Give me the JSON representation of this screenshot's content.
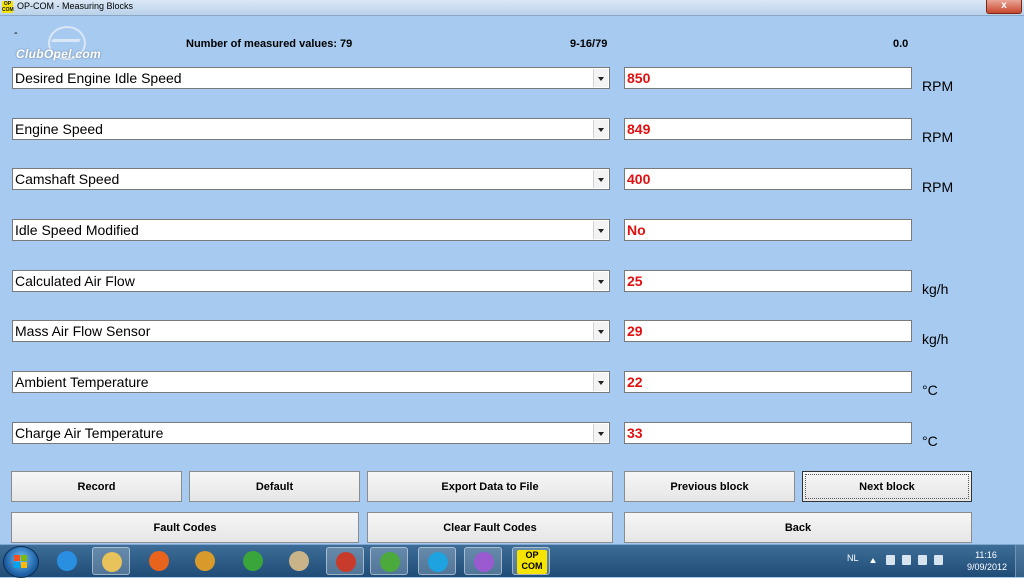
{
  "window": {
    "title": "OP-COM - Measuring Blocks",
    "app_icon_text": "OP COM",
    "close_label": "x"
  },
  "logo": {
    "dash": "-",
    "text": "ClubOpel.com"
  },
  "header": {
    "count_label": "Number of measured values: 79",
    "range": "9-16/79",
    "value": "0.0"
  },
  "rows": [
    {
      "label": "Desired Engine Idle Speed",
      "value": "850",
      "unit": "RPM"
    },
    {
      "label": "Engine Speed",
      "value": "849",
      "unit": "RPM"
    },
    {
      "label": "Camshaft Speed",
      "value": "400",
      "unit": "RPM"
    },
    {
      "label": "Idle Speed Modified",
      "value": "No",
      "unit": ""
    },
    {
      "label": "Calculated Air Flow",
      "value": "25",
      "unit": "kg/h"
    },
    {
      "label": "Mass Air Flow Sensor",
      "value": "29",
      "unit": "kg/h"
    },
    {
      "label": "Ambient Temperature",
      "value": "22",
      "unit": "°C"
    },
    {
      "label": "Charge Air Temperature",
      "value": "33",
      "unit": "°C"
    }
  ],
  "buttons": {
    "record": "Record",
    "default": "Default",
    "export": "Export Data to File",
    "previous": "Previous block",
    "next": "Next block",
    "fault_codes": "Fault Codes",
    "clear_fault_codes": "Clear Fault Codes",
    "back": "Back"
  },
  "taskbar": {
    "items": [
      {
        "icon": "internet-explorer-icon",
        "color": "#2a8fe0"
      },
      {
        "icon": "file-explorer-icon",
        "color": "#e8c25a"
      },
      {
        "icon": "firefox-icon",
        "color": "#e8641c"
      },
      {
        "icon": "winamp-icon",
        "color": "#d89a2a"
      },
      {
        "icon": "chrome-icon",
        "color": "#3aa53a"
      },
      {
        "icon": "paint-icon",
        "color": "#c9b48a"
      },
      {
        "icon": "media-player-icon",
        "color": "#c83a2a"
      },
      {
        "icon": "utorrent-icon",
        "color": "#4caa3c"
      },
      {
        "icon": "skype-icon",
        "color": "#1fa2e0"
      },
      {
        "icon": "messenger-icon",
        "color": "#9a5ad0"
      }
    ],
    "opcom_label_1": "OP",
    "opcom_label_2": "COM",
    "lang": "NL",
    "time": "11:16",
    "date": "9/09/2012"
  },
  "colors": {
    "background": "#a6caf0",
    "value_text": "#e01010"
  }
}
